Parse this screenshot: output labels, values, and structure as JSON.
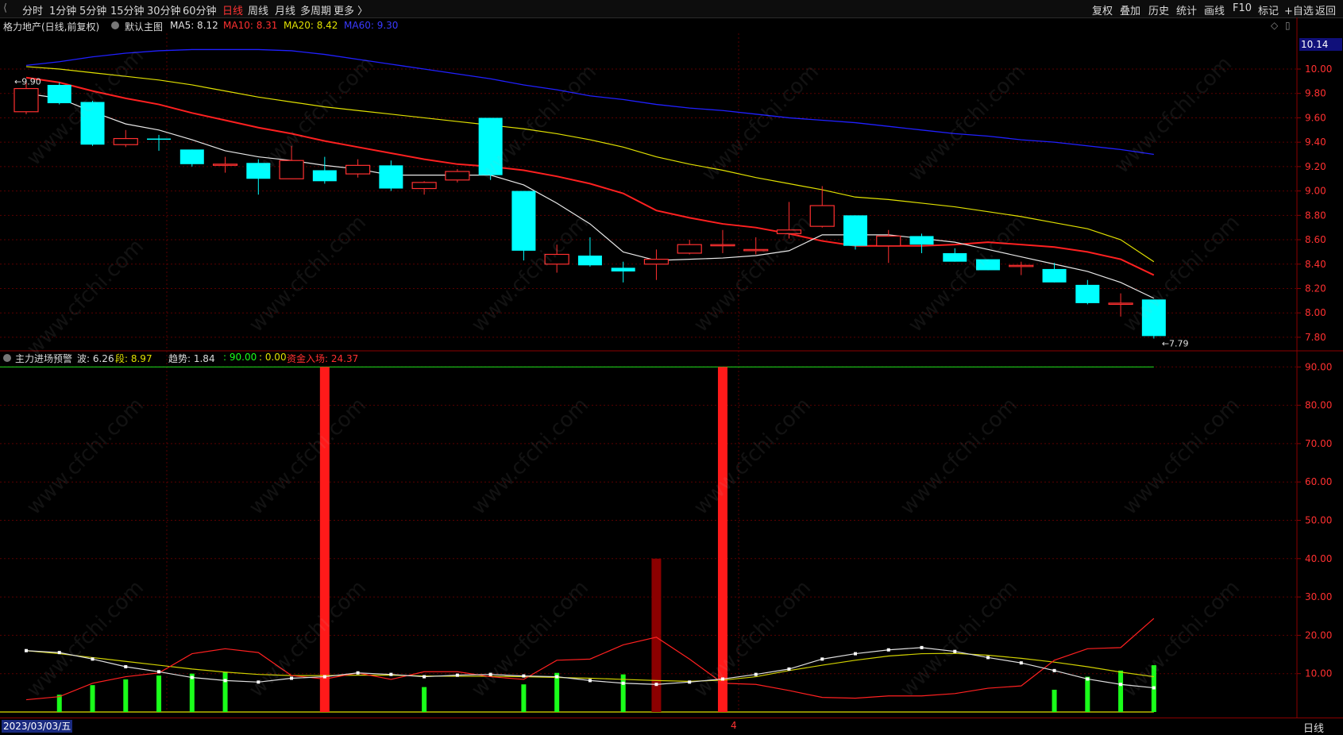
{
  "toolbar": {
    "periods": [
      "分时",
      "1分钟",
      "5分钟",
      "15分钟",
      "30分钟",
      "60分钟",
      "日线",
      "周线",
      "月线",
      "多周期",
      "更多 〉"
    ],
    "active_period": "日线",
    "right_items": [
      "复权",
      "叠加",
      "历史",
      "统计",
      "画线",
      "F10",
      "标记",
      "+自选",
      "返回"
    ]
  },
  "main_panel": {
    "stock_title": "格力地产(日线,前复权)",
    "template_label": "默认主图",
    "ma5": {
      "label": "MA5: 8.12",
      "color": "#e0e0e0"
    },
    "ma10": {
      "label": "MA10: 8.31",
      "color": "#ff3030"
    },
    "ma20": {
      "label": "MA20: 8.42",
      "color": "#e0e000"
    },
    "ma60": {
      "label": "MA60: 9.30",
      "color": "#3030ff"
    },
    "current_price_box": "10.14",
    "y_ticks": [
      "10.00",
      "9.80",
      "9.60",
      "9.40",
      "9.20",
      "9.00",
      "8.80",
      "8.60",
      "8.40",
      "8.20",
      "8.00",
      "7.80"
    ],
    "high_marker": "9.90",
    "low_marker": "7.79"
  },
  "indicator_panel": {
    "name": "主力进场预警",
    "wave": "波: 6.26",
    "segment": "段: 8.97",
    "trend": "趋势: 1.84",
    "val1": ": 90.00",
    "val2": ": 0.00",
    "capital": "资金入场: 24.37",
    "y_ticks": [
      "90.00",
      "80.00",
      "70.00",
      "60.00",
      "50.00",
      "40.00",
      "30.00",
      "20.00",
      "10.00"
    ]
  },
  "bottom": {
    "date": "2023/03/03/五",
    "cursor_label": "4",
    "period": "日线"
  },
  "watermark": "www.cfchi.com",
  "colors": {
    "up": "#ff3030",
    "down": "#00ffff",
    "grid": "#5a0000",
    "axis": "#8b0000",
    "signal_bar": "#ff1a1a",
    "dark_bar": "#8b0000",
    "green_bar": "#1aff1a"
  },
  "chart_data": {
    "type": "candlestick",
    "candles": [
      {
        "o": 9.65,
        "h": 9.91,
        "l": 9.63,
        "c": 9.84
      },
      {
        "o": 9.87,
        "h": 9.89,
        "l": 9.71,
        "c": 9.72
      },
      {
        "o": 9.73,
        "h": 9.74,
        "l": 9.37,
        "c": 9.38
      },
      {
        "o": 9.38,
        "h": 9.5,
        "l": 9.36,
        "c": 9.43
      },
      {
        "o": 9.43,
        "h": 9.46,
        "l": 9.33,
        "c": 9.42
      },
      {
        "o": 9.34,
        "h": 9.34,
        "l": 9.2,
        "c": 9.22
      },
      {
        "o": 9.22,
        "h": 9.28,
        "l": 9.15,
        "c": 9.22
      },
      {
        "o": 9.23,
        "h": 9.26,
        "l": 8.97,
        "c": 9.1
      },
      {
        "o": 9.1,
        "h": 9.37,
        "l": 9.1,
        "c": 9.25
      },
      {
        "o": 9.17,
        "h": 9.28,
        "l": 9.06,
        "c": 9.08
      },
      {
        "o": 9.14,
        "h": 9.26,
        "l": 9.11,
        "c": 9.21
      },
      {
        "o": 9.21,
        "h": 9.25,
        "l": 9.0,
        "c": 9.02
      },
      {
        "o": 9.02,
        "h": 9.08,
        "l": 8.97,
        "c": 9.07
      },
      {
        "o": 9.09,
        "h": 9.18,
        "l": 9.07,
        "c": 9.16
      },
      {
        "o": 9.6,
        "h": 9.6,
        "l": 9.09,
        "c": 9.13
      },
      {
        "o": 9.0,
        "h": 9.0,
        "l": 8.43,
        "c": 8.51
      },
      {
        "o": 8.4,
        "h": 8.56,
        "l": 8.33,
        "c": 8.48
      },
      {
        "o": 8.47,
        "h": 8.62,
        "l": 8.38,
        "c": 8.39
      },
      {
        "o": 8.37,
        "h": 8.42,
        "l": 8.25,
        "c": 8.34
      },
      {
        "o": 8.4,
        "h": 8.52,
        "l": 8.27,
        "c": 8.44
      },
      {
        "o": 8.49,
        "h": 8.6,
        "l": 8.48,
        "c": 8.56
      },
      {
        "o": 8.56,
        "h": 8.68,
        "l": 8.49,
        "c": 8.56
      },
      {
        "o": 8.52,
        "h": 8.62,
        "l": 8.48,
        "c": 8.52
      },
      {
        "o": 8.65,
        "h": 8.91,
        "l": 8.61,
        "c": 8.68
      },
      {
        "o": 8.71,
        "h": 9.04,
        "l": 8.7,
        "c": 8.88
      },
      {
        "o": 8.8,
        "h": 8.8,
        "l": 8.52,
        "c": 8.55
      },
      {
        "o": 8.55,
        "h": 8.68,
        "l": 8.41,
        "c": 8.63
      },
      {
        "o": 8.63,
        "h": 8.65,
        "l": 8.49,
        "c": 8.56
      },
      {
        "o": 8.49,
        "h": 8.53,
        "l": 8.42,
        "c": 8.42
      },
      {
        "o": 8.44,
        "h": 8.44,
        "l": 8.35,
        "c": 8.35
      },
      {
        "o": 8.39,
        "h": 8.42,
        "l": 8.31,
        "c": 8.39
      },
      {
        "o": 8.36,
        "h": 8.41,
        "l": 8.25,
        "c": 8.25
      },
      {
        "o": 8.23,
        "h": 8.27,
        "l": 8.07,
        "c": 8.08
      },
      {
        "o": 8.07,
        "h": 8.16,
        "l": 7.97,
        "c": 8.08
      },
      {
        "o": 8.11,
        "h": 8.11,
        "l": 7.79,
        "c": 7.81
      }
    ],
    "ma5": [
      9.8,
      9.76,
      9.65,
      9.55,
      9.5,
      9.42,
      9.33,
      9.28,
      9.25,
      9.21,
      9.18,
      9.13,
      9.13,
      9.13,
      9.13,
      9.05,
      8.9,
      8.73,
      8.5,
      8.43,
      8.44,
      8.45,
      8.47,
      8.51,
      8.64,
      8.64,
      8.64,
      8.61,
      8.58,
      8.52,
      8.46,
      8.4,
      8.34,
      8.25,
      8.12
    ],
    "ma10": [
      9.93,
      9.89,
      9.82,
      9.76,
      9.71,
      9.64,
      9.58,
      9.52,
      9.47,
      9.41,
      9.36,
      9.31,
      9.26,
      9.22,
      9.2,
      9.17,
      9.12,
      9.06,
      8.98,
      8.84,
      8.78,
      8.73,
      8.7,
      8.65,
      8.59,
      8.55,
      8.55,
      8.55,
      8.56,
      8.58,
      8.56,
      8.54,
      8.5,
      8.44,
      8.31
    ],
    "ma20": [
      10.02,
      10.0,
      9.97,
      9.94,
      9.91,
      9.87,
      9.82,
      9.77,
      9.73,
      9.69,
      9.66,
      9.63,
      9.6,
      9.57,
      9.54,
      9.51,
      9.47,
      9.42,
      9.36,
      9.28,
      9.22,
      9.17,
      9.11,
      9.06,
      9.01,
      8.95,
      8.93,
      8.9,
      8.87,
      8.83,
      8.79,
      8.74,
      8.69,
      8.6,
      8.42
    ],
    "ma60": [
      10.03,
      10.06,
      10.1,
      10.13,
      10.15,
      10.16,
      10.16,
      10.16,
      10.15,
      10.12,
      10.08,
      10.04,
      10.0,
      9.96,
      9.92,
      9.87,
      9.83,
      9.78,
      9.75,
      9.71,
      9.68,
      9.66,
      9.63,
      9.6,
      9.58,
      9.56,
      9.53,
      9.5,
      9.47,
      9.45,
      9.42,
      9.4,
      9.37,
      9.34,
      9.3
    ],
    "indicator": {
      "green_bars": [
        null,
        4.5,
        7,
        8.5,
        9.5,
        10,
        10.5,
        null,
        null,
        null,
        null,
        null,
        6.5,
        null,
        null,
        7.2,
        10.2,
        null,
        9.8,
        null,
        null,
        null,
        null,
        null,
        null,
        null,
        null,
        null,
        null,
        null,
        null,
        5.8,
        9.2,
        10.8,
        12.2
      ],
      "red_signal_bars": [
        {
          "index": 9,
          "value": 90
        },
        {
          "index": 21,
          "value": 90
        }
      ],
      "dark_bar": {
        "index": 19,
        "value": 40
      },
      "white_line": [
        16,
        15.5,
        13.8,
        11.8,
        10.5,
        9,
        8.2,
        7.8,
        8.8,
        9.2,
        10.2,
        9.8,
        9.2,
        9.6,
        9.8,
        9.4,
        9.2,
        8.2,
        7.5,
        7.2,
        7.8,
        8.6,
        9.8,
        11.2,
        13.8,
        15.2,
        16.2,
        16.8,
        15.8,
        14.2,
        12.8,
        10.8,
        8.6,
        7.2,
        6.3
      ],
      "yellow_line": [
        16,
        15.2,
        14.2,
        13.2,
        12.2,
        11.2,
        10.4,
        9.8,
        9.5,
        9.5,
        9.6,
        9.6,
        9.4,
        9.3,
        9.3,
        9.2,
        9.0,
        8.8,
        8.5,
        8.2,
        8.0,
        8.3,
        9.2,
        10.8,
        12.2,
        13.5,
        14.6,
        15.2,
        15.3,
        14.8,
        14.0,
        13.0,
        11.8,
        10.4,
        9.2
      ],
      "red_line": [
        3.2,
        4,
        7.5,
        9.2,
        10.2,
        15.2,
        16.5,
        15.5,
        9.5,
        8.6,
        10.2,
        8.5,
        10.5,
        10.5,
        9.2,
        8.5,
        13.5,
        13.8,
        17.5,
        19.5,
        13.8,
        7.5,
        7.2,
        5.6,
        3.8,
        3.6,
        4.2,
        4.2,
        4.8,
        6.2,
        6.8,
        13.5,
        16.5,
        16.8,
        24.4
      ],
      "y_range": [
        0,
        90
      ]
    }
  }
}
